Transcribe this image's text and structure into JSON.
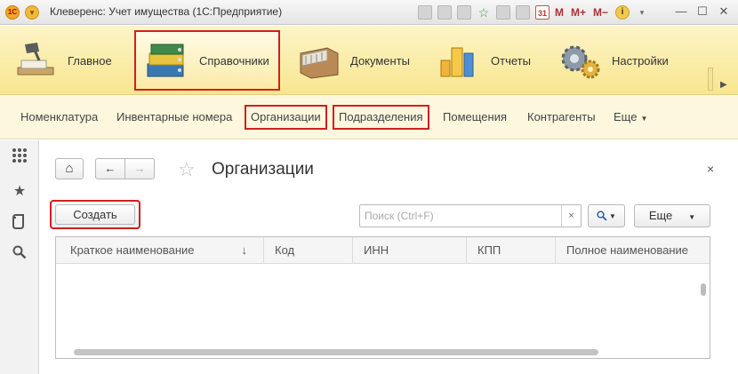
{
  "window": {
    "title": "Клеверенс: Учет имущества  (1С:Предприятие)",
    "logo_text": "1С",
    "m_buttons": [
      "M",
      "M+",
      "M−"
    ],
    "calendar_day": "31",
    "info_glyph": "i",
    "minimize": "—",
    "maximize": "☐",
    "close": "✕"
  },
  "sections": [
    {
      "label": "Главное",
      "icon": "desk-lamp-icon",
      "active": false
    },
    {
      "label": "Справочники",
      "icon": "binders-icon",
      "active": true
    },
    {
      "label": "Документы",
      "icon": "file-cabinet-icon",
      "active": false
    },
    {
      "label": "Отчеты",
      "icon": "bar-chart-icon",
      "active": false
    },
    {
      "label": "Настройки",
      "icon": "gears-icon",
      "active": false
    }
  ],
  "subnav": [
    {
      "label": "Номенклатура"
    },
    {
      "label": "Инвентарные номера"
    },
    {
      "label": "Организации"
    },
    {
      "label": "Подразделения"
    },
    {
      "label": "Помещения"
    },
    {
      "label": "Контрагенты"
    },
    {
      "label": "Еще"
    }
  ],
  "leftbar": {
    "menu_glyph": "⋮⋮⋮",
    "favorites_glyph": "★",
    "history_glyph": "⟲",
    "search_glyph": "🔍"
  },
  "form": {
    "title": "Организации",
    "home_glyph": "⌂",
    "back_glyph": "←",
    "forward_glyph": "→",
    "star_glyph": "☆",
    "close_glyph": "×",
    "create_label": "Создать",
    "search_placeholder": "Поиск (Ctrl+F)",
    "search_value": "",
    "search_clear_glyph": "×",
    "search_mode_glyph": "🔍▾",
    "more_label": "Еще",
    "more_caret": "▾"
  },
  "table": {
    "columns": [
      "Краткое наименование",
      "Код",
      "ИНН",
      "КПП",
      "Полное наименование"
    ],
    "sort_glyph": "↓",
    "rows": []
  },
  "colors": {
    "highlight": "#d21f1f",
    "sections_bg": "#f8e68f",
    "subnav_bg": "#fdf7de"
  }
}
